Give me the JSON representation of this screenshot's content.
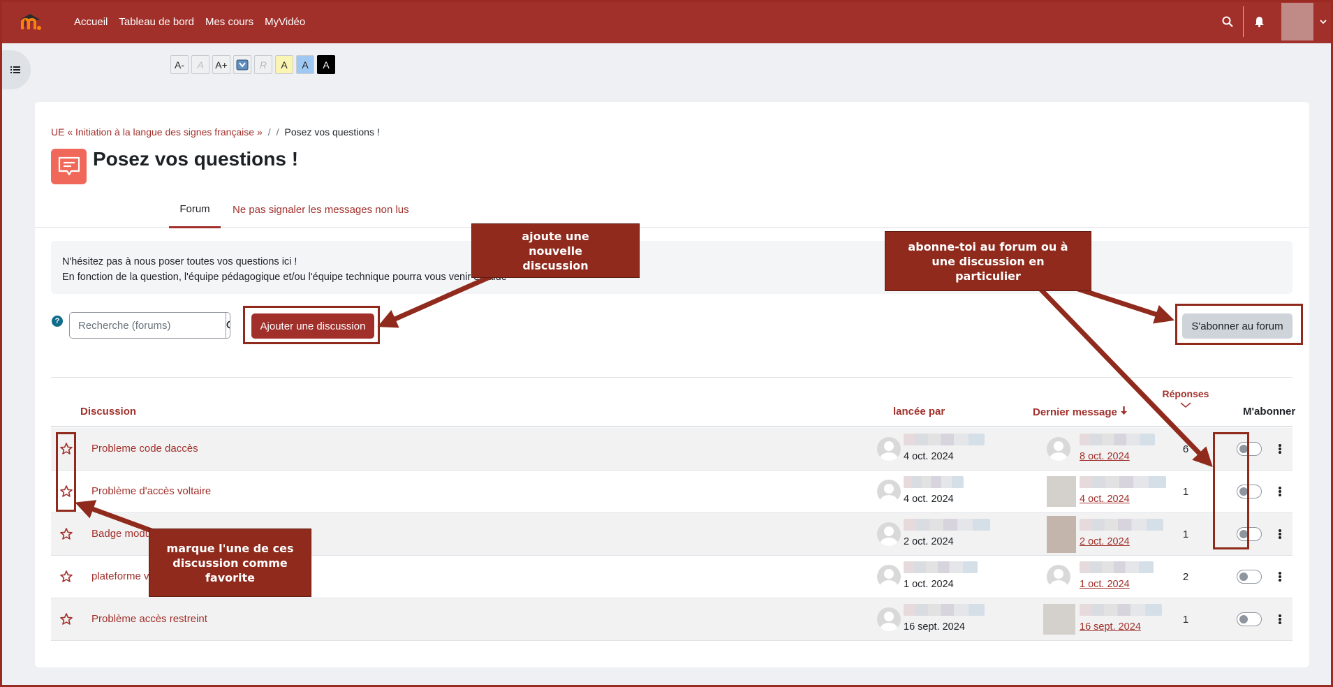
{
  "navbar": {
    "links": [
      "Accueil",
      "Tableau de bord",
      "Mes cours",
      "MyVidéo"
    ],
    "brand_color": "#a1302b"
  },
  "a11y_toolbar": [
    "A-",
    "A",
    "A+",
    "",
    "R",
    "A",
    "A",
    "A"
  ],
  "breadcrumb": {
    "course": "UE « Initiation à la langue des signes française »",
    "sep1": "/",
    "sep2": "/",
    "current": "Posez vos questions !"
  },
  "page": {
    "title": "Posez vos questions !",
    "tabs": [
      "Forum",
      "Ne pas signaler les messages non lus"
    ],
    "intro_line1": "N'hésitez pas à nous poser toutes vos questions ici !",
    "intro_line2": "En fonction de la question, l'équipe pédagogique et/ou l'équipe technique pourra vous venir en aide"
  },
  "toolbar": {
    "search_placeholder": "Recherche (forums)",
    "add_label": "Ajouter une discussion",
    "subscribe_label": "S'abonner au forum"
  },
  "table": {
    "headers": {
      "discussion": "Discussion",
      "started_by": "lancée par",
      "last_post": "Dernier message",
      "replies": "Réponses",
      "subscribe": "M'abonner"
    },
    "rows": [
      {
        "title": "Probleme code daccès",
        "started": "4 oct. 2024",
        "last": "8 oct. 2024",
        "replies": "6"
      },
      {
        "title": "Problème d'accès voltaire",
        "started": "4 oct. 2024",
        "last": "4 oct. 2024",
        "replies": "1"
      },
      {
        "title": "Badge modu",
        "started": "2 oct. 2024",
        "last": "2 oct. 2024",
        "replies": "1"
      },
      {
        "title": "plateforme v",
        "started": "1 oct. 2024",
        "last": "1 oct. 2024",
        "replies": "2"
      },
      {
        "title": "Problème accès restreint",
        "started": "16 sept. 2024",
        "last": "16 sept. 2024",
        "replies": "1"
      }
    ]
  },
  "annotations": {
    "add": "ajoute une nouvelle discussion",
    "subscribe": "abonne-toi au forum ou à une discussion en particulier",
    "favorite": "marque l'une de ces discussion comme favorite",
    "color": "#8f2a1c"
  }
}
